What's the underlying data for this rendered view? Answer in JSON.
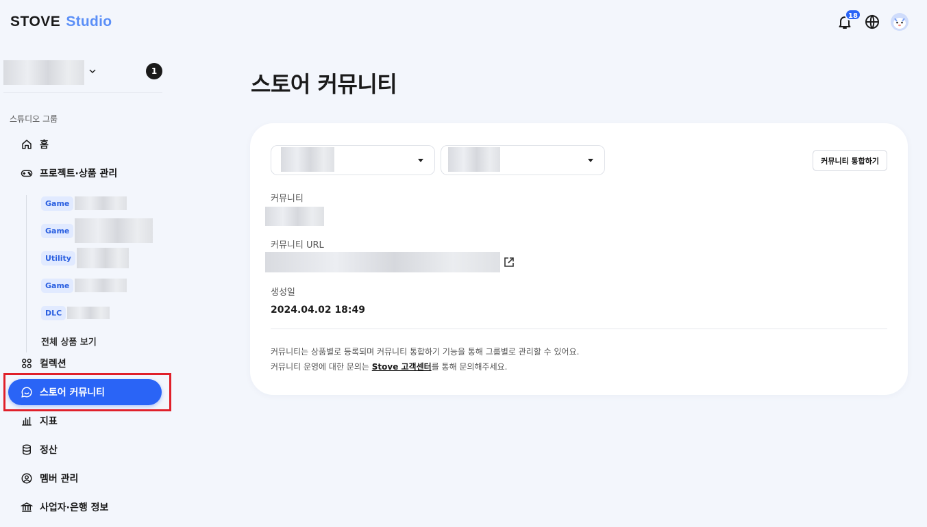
{
  "header": {
    "logo_primary": "STOVE",
    "logo_secondary": "Studio",
    "notification_count": "18",
    "icons": [
      "bell-icon",
      "globe-icon",
      "avatar"
    ]
  },
  "sidebar": {
    "studio_notification_count": "1",
    "group_label": "스튜디오 그룹",
    "items": [
      {
        "label": "홈",
        "icon": "home-icon"
      },
      {
        "label": "프로젝트·상품 관리",
        "icon": "gamepad-icon"
      },
      {
        "label": "컬렉션",
        "icon": "collection-icon"
      },
      {
        "label": "스토어 커뮤니티",
        "icon": "chat-icon",
        "active": true
      },
      {
        "label": "지표",
        "icon": "chart-icon"
      },
      {
        "label": "정산",
        "icon": "database-icon"
      },
      {
        "label": "멤버 관리",
        "icon": "user-icon"
      },
      {
        "label": "사업자·은행 정보",
        "icon": "bank-icon"
      }
    ],
    "products": [
      {
        "tag": "Game"
      },
      {
        "tag": "Game"
      },
      {
        "tag": "Utility"
      },
      {
        "tag": "Game"
      },
      {
        "tag": "DLC"
      }
    ],
    "view_all_label": "전체 상품 보기"
  },
  "main": {
    "title": "스토어 커뮤니티",
    "merge_button": "커뮤니티 통합하기",
    "community_label": "커뮤니티",
    "url_label": "커뮤니티 URL",
    "created_label": "생성일",
    "created_value": "2024.04.02 18:49",
    "notice_line1": "커뮤니티는 상품별로 등록되며 커뮤니티 통합하기 기능을 통해 그룹별로 관리할 수 있어요.",
    "notice_line2_prefix": "커뮤니티 운영에 대한 문의는 ",
    "notice_link": "Stove 고객센터",
    "notice_line2_suffix": "를 통해 문의해주세요."
  },
  "colors": {
    "accent": "#2a64f6",
    "background": "#f3f6fc",
    "highlight": "#e0202a",
    "tag_bg": "#e1eaff"
  }
}
